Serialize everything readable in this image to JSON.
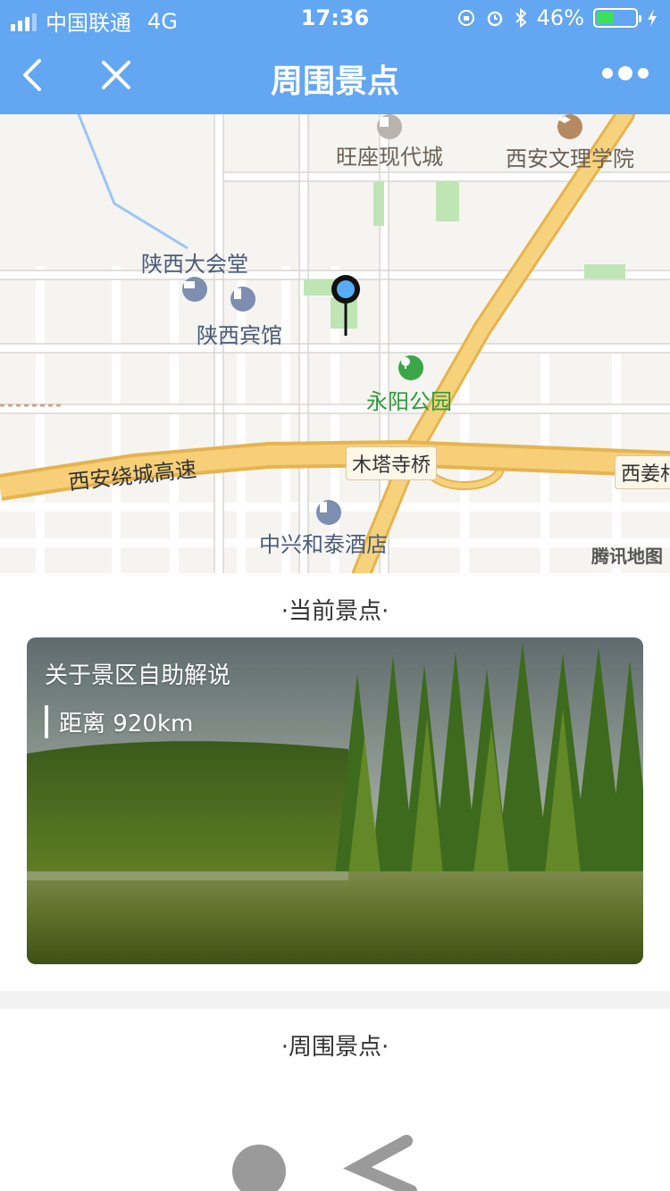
{
  "status_bar": {
    "carrier": "中国联通",
    "network": "4G",
    "time": "17:36",
    "battery_percent": "46%",
    "battery_level": 0.46
  },
  "nav": {
    "title": "周围景点",
    "back_icon": "chevron-left-icon",
    "close_icon": "close-icon",
    "more_icon": "more-dots-icon"
  },
  "map": {
    "labels": {
      "wangzuo": "旺座现代城",
      "wenli": "西安文理学院",
      "dahuitang": "陕西大会堂",
      "binguan": "陕西宾馆",
      "park": "永阳公园",
      "highway": "西安绕城高速",
      "mutasi": "木塔寺桥",
      "xijiang": "西姜村",
      "hotel": "中兴和泰酒店"
    },
    "credit": "腾讯地图"
  },
  "current_section": {
    "title": "·当前景点·"
  },
  "card": {
    "title": "关于景区自助解说",
    "distance": "距离 920km"
  },
  "nearby_section": {
    "title": "·周围景点·"
  },
  "colors": {
    "primary": "#63a6f1",
    "road": "#f7c96a",
    "park_green": "#2e9a3a"
  }
}
